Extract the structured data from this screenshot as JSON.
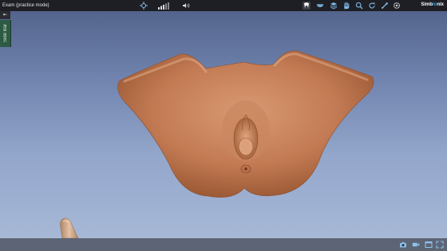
{
  "window": {
    "title": "Exam (practice mode)"
  },
  "sidebar": {
    "collapse_glyph": "⇤",
    "tab_label": "Side Bar"
  },
  "brand": {
    "name_part1": "Simb",
    "name_accent": "io",
    "name_part2": "nix"
  },
  "toolbar": {
    "center_icons": [
      "crosshair-icon",
      "signal-strength-icon",
      "audio-icon"
    ],
    "tools": [
      "dental-view-icon",
      "jaw-view-icon",
      "layers-icon",
      "hand-pan-icon",
      "zoom-icon",
      "rotate-icon",
      "probe-icon",
      "settings-icon"
    ],
    "active_tool": "dental-view-icon"
  },
  "status_bar": {
    "icons": [
      "camera-icon",
      "video-icon",
      "window-icon",
      "maximize-icon"
    ]
  },
  "colors": {
    "toolbar_bg": "#1e1f24",
    "side_tab_bg": "#2c5a42",
    "brand_accent": "#2f9be6",
    "viewport_top": "#4f5f86",
    "viewport_bottom": "#aabbd8",
    "model_skin": "#c97f58"
  }
}
